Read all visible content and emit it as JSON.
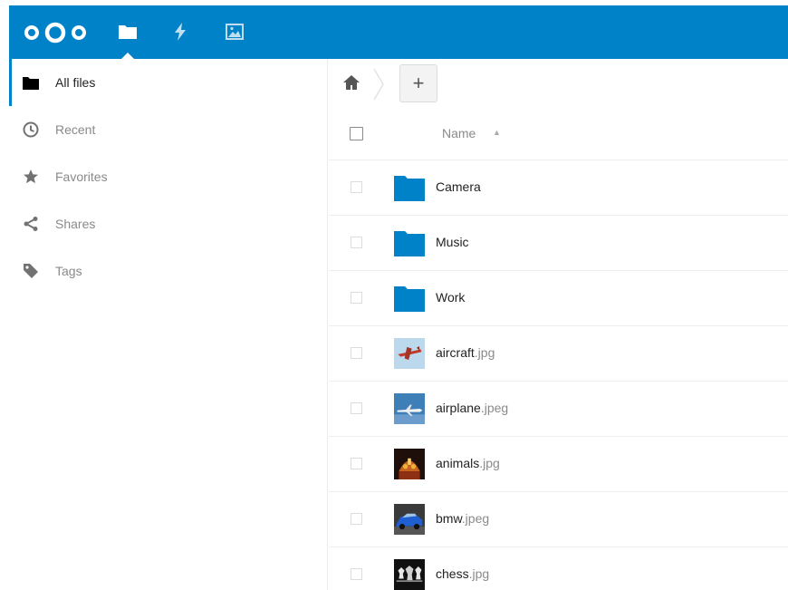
{
  "colors": {
    "primary": "#0082c9",
    "folder": "#0082c9"
  },
  "header": {
    "logo_icon": "nextcloud-logo-icon",
    "apps": [
      {
        "name": "files-app-icon",
        "active": true
      },
      {
        "name": "activity-app-icon",
        "active": false
      },
      {
        "name": "gallery-app-icon",
        "active": false
      }
    ]
  },
  "sidebar": {
    "items": [
      {
        "label": "All files",
        "icon": "folder-icon",
        "active": true
      },
      {
        "label": "Recent",
        "icon": "clock-icon"
      },
      {
        "label": "Favorites",
        "icon": "star-icon"
      },
      {
        "label": "Shares",
        "icon": "share-icon"
      },
      {
        "label": "Tags",
        "icon": "tag-icon"
      }
    ]
  },
  "controls": {
    "home_icon": "home-icon",
    "new_label": "+"
  },
  "list": {
    "name_header": "Name",
    "sort_indicator": "▲",
    "files": [
      {
        "base": "Camera",
        "ext": "",
        "type": "folder"
      },
      {
        "base": "Music",
        "ext": "",
        "type": "folder"
      },
      {
        "base": "Work",
        "ext": "",
        "type": "folder"
      },
      {
        "base": "aircraft",
        "ext": ".jpg",
        "type": "image",
        "thumb": "aircraft-thumbnail"
      },
      {
        "base": "airplane",
        "ext": ".jpeg",
        "type": "image",
        "thumb": "airplane-thumbnail"
      },
      {
        "base": "animals",
        "ext": ".jpg",
        "type": "image",
        "thumb": "animals-thumbnail"
      },
      {
        "base": "bmw",
        "ext": ".jpeg",
        "type": "image",
        "thumb": "bmw-thumbnail"
      },
      {
        "base": "chess",
        "ext": ".jpg",
        "type": "image",
        "thumb": "chess-thumbnail"
      }
    ]
  }
}
